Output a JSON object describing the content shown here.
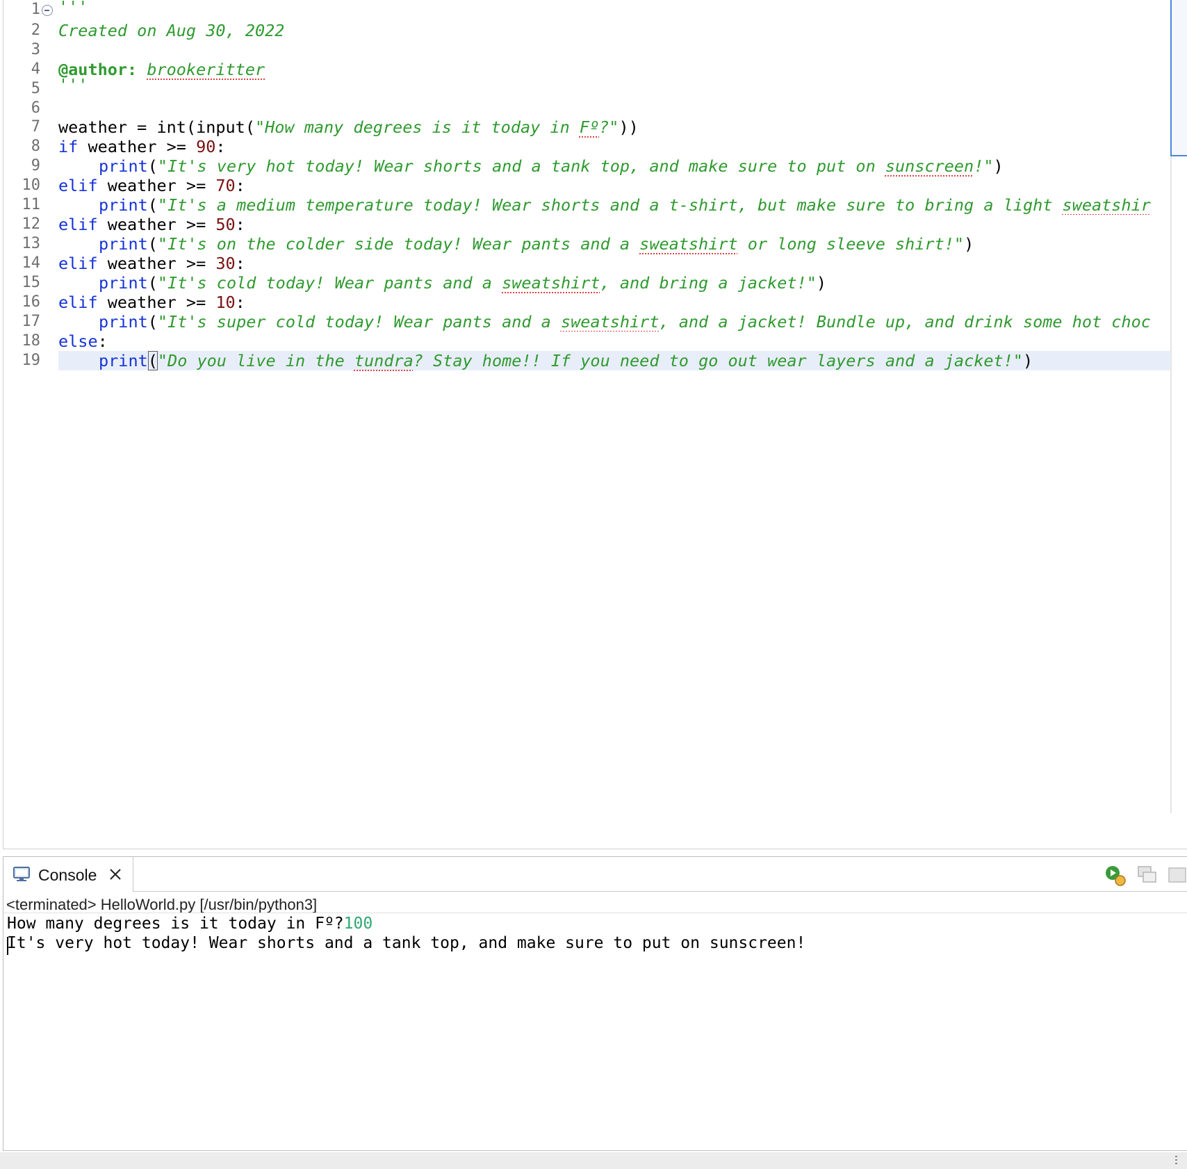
{
  "editor": {
    "line_numbers": [
      "1",
      "2",
      "3",
      "4",
      "5",
      "6",
      "7",
      "8",
      "9",
      "10",
      "11",
      "12",
      "13",
      "14",
      "15",
      "16",
      "17",
      "18",
      "19"
    ],
    "lines": {
      "l1": "'''",
      "l2": "Created on Aug 30, 2022",
      "l4_tag": "@author:",
      "l4_name": "brookeritter",
      "l5": "'''",
      "l7": {
        "a": "weather = int(input(",
        "s": "\"How many degrees is it today in ",
        "sq": "Fº",
        "s2": "?\"",
        "b": "))"
      },
      "l8": {
        "kw": "if",
        "a": " weather >= ",
        "num": "90",
        "b": ":"
      },
      "l9": {
        "kw": "print",
        "a": "(",
        "s": "\"It's very hot today! Wear shorts and a tank top, and make sure to put on ",
        "sq": "sunscreen",
        "s2": "!\"",
        "b": ")"
      },
      "l10": {
        "kw": "elif",
        "a": " weather >= ",
        "num": "70",
        "b": ":"
      },
      "l11": {
        "kw": "print",
        "a": "(",
        "s": "\"It's a medium temperature today! Wear shorts and a t-shirt, but make sure to bring a light ",
        "sq": "sweatshir"
      },
      "l12": {
        "kw": "elif",
        "a": " weather >= ",
        "num": "50",
        "b": ":"
      },
      "l13": {
        "kw": "print",
        "a": "(",
        "s": "\"It's on the colder side today! Wear pants and a ",
        "sq": "sweatshirt",
        "s2": " or long sleeve shirt!\"",
        "b": ")"
      },
      "l14": {
        "kw": "elif",
        "a": " weather >= ",
        "num": "30",
        "b": ":"
      },
      "l15": {
        "kw": "print",
        "a": "(",
        "s": "\"It's cold today! Wear pants and a ",
        "sq": "sweatshirt",
        "s2": ", and bring a jacket!\"",
        "b": ")"
      },
      "l16": {
        "kw": "elif",
        "a": " weather >= ",
        "num": "10",
        "b": ":"
      },
      "l17": {
        "kw": "print",
        "a": "(",
        "s": "\"It's super cold today! Wear pants and a ",
        "sq": "sweatshirt",
        "s2": ", and a jacket! Bundle up, and drink some hot choc"
      },
      "l18": {
        "kw": "else",
        "b": ":"
      },
      "l19": {
        "kw": "print",
        "a": "(",
        "s": "\"Do you live in the ",
        "sq": "tundra",
        "s2": "? Stay home!! If you need to go out wear layers and a jacket!\"",
        "b": ")"
      }
    }
  },
  "console": {
    "tab_label": "Console",
    "icons": {
      "tab": "console-monitor-icon",
      "close": "close-icon",
      "actions": [
        "debug-terminate-icon",
        "display-console-icon",
        "pin-console-icon"
      ]
    },
    "process": "<terminated> HelloWorld.py [/usr/bin/python3]",
    "output": {
      "prompt": "How many degrees is it today in Fº?",
      "user_input": "100",
      "result": "It's very hot today! Wear shorts and a tank top, and make sure to put on sunscreen!"
    }
  },
  "colors": {
    "keyword": "#1432d8",
    "string": "#2f9a2f",
    "number": "#7a1010",
    "console_input": "#2fa872",
    "current_line": "#e8eef9"
  }
}
